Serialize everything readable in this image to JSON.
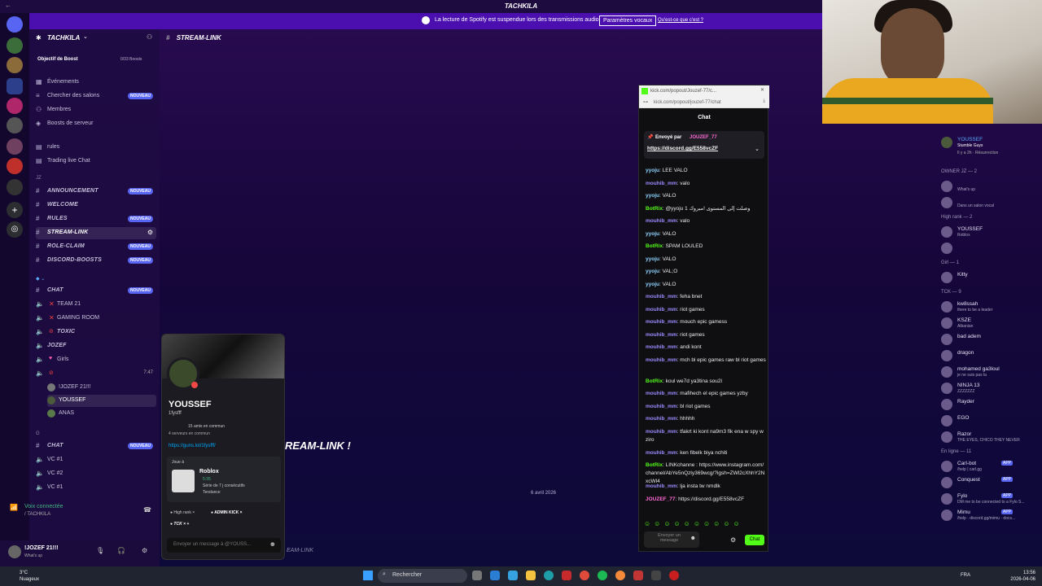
{
  "window": {
    "title": "TACHKILA"
  },
  "notice": {
    "message": "La lecture de Spotify est suspendue lors des transmissions audio.",
    "button": "Paramètres vocaux",
    "link": "Qu'est-ce que c'est ?"
  },
  "sidebar": {
    "guild_name": "TACHKILA",
    "boost_label": "Objectif de Boost",
    "boost_count": "0/33 Boosts",
    "top_items": [
      {
        "label": "Événements"
      },
      {
        "label": "Chercher des salons",
        "tag": "NOUVEAU"
      },
      {
        "label": "Membres"
      },
      {
        "label": "Boosts de serveur"
      }
    ],
    "misc_items": [
      {
        "label": "rules"
      },
      {
        "label": "Trading live Chat"
      }
    ],
    "cat_jz": "JZ",
    "jz_channels": [
      {
        "label": "ANNOUNCEMENT",
        "tag": "NOUVEAU"
      },
      {
        "label": "WELCOME"
      },
      {
        "label": "RULES",
        "tag": "NOUVEAU"
      },
      {
        "label": "STREAM-LINK"
      },
      {
        "label": "ROLE-CLAIM",
        "tag": "NOUVEAU"
      },
      {
        "label": "DISCORD-BOOSTS",
        "tag": "NOUVEAU"
      }
    ],
    "chat_channel": {
      "label": "CHAT",
      "tag": "NOUVEAU"
    },
    "voice_channels": [
      {
        "label": "TEAM 21"
      },
      {
        "label": "GAMING ROOM"
      },
      {
        "label": "TOXIC"
      },
      {
        "label": "JOZEF"
      },
      {
        "label": "Girls"
      }
    ],
    "voice_time": "7:47",
    "voice_users": [
      "!JOZEF 21!!!",
      "YOUSSEF",
      "ANAS"
    ],
    "cat_g": "G",
    "g_channels": [
      {
        "label": "CHAT",
        "tag": "NOUVEAU"
      },
      {
        "label": "VC #1"
      },
      {
        "label": "VC #2"
      },
      {
        "label": "VC #1"
      }
    ],
    "voice_status": "Voix connectée",
    "voice_server": "/ TACHKILA",
    "user_name": "!JOZEF 21!!!",
    "user_status": "What's up"
  },
  "channel_header": "STREAM-LINK",
  "stream": {
    "overlay_text": "REAM-LINK !",
    "date": "6 avril 2026",
    "footer": "EAM-LINK"
  },
  "profile": {
    "name": "YOUSSEF",
    "handle": "1fysfff",
    "mutual_friends": "15 amis en commun",
    "mutual_servers": "4 serveurs en commun",
    "link": "https://guns.lol/1fysfff/",
    "playing_label": "Joue à",
    "game": "Roblox",
    "game_time": "5:35",
    "streak": "Série de 7 j consécutifs",
    "trend": "Tendance",
    "roles": [
      "High rank",
      "ADMIN KICK",
      "TCK"
    ],
    "message_placeholder": "Envoyer un message à @YOUSS..."
  },
  "kick": {
    "tab_title": "kick.com/popout/Jouzef-77/c...",
    "url": "kick.com/popout/jouzef-77/chat",
    "title": "Chat",
    "pinned_by_label": "Envoyé par",
    "pinned_by": "JOUZEF_77",
    "pinned_link": "https://discord.gg/E558vcZF",
    "messages": [
      {
        "u": "yyoju",
        "t": "LEE VALO",
        "c": "#8fd3ff"
      },
      {
        "u": "mouhib_mm",
        "t": "valo",
        "c": "#9b8cff"
      },
      {
        "u": "yyoju",
        "t": "VALO",
        "c": "#8fd3ff"
      },
      {
        "u": "BotRix",
        "t": "@yyoju 1 وصلت إلى المستوى !مبروك",
        "c": "#53fc18"
      },
      {
        "u": "mouhib_mm",
        "t": "valo",
        "c": "#9b8cff"
      },
      {
        "u": "yyoju",
        "t": "VALO",
        "c": "#8fd3ff"
      },
      {
        "u": "BotRix",
        "t": "SPAM LOULED",
        "c": "#53fc18"
      },
      {
        "u": "yyoju",
        "t": "VALO",
        "c": "#8fd3ff"
      },
      {
        "u": "yyoju",
        "t": "VAL;O",
        "c": "#8fd3ff"
      },
      {
        "u": "yyoju",
        "t": "VALO",
        "c": "#8fd3ff"
      },
      {
        "u": "mouhib_mm",
        "t": "feha bnet",
        "c": "#9b8cff"
      },
      {
        "u": "mouhib_mm",
        "t": "riot games",
        "c": "#9b8cff"
      },
      {
        "u": "mouhib_mm",
        "t": "mouch epic gamess",
        "c": "#9b8cff"
      },
      {
        "u": "mouhib_mm",
        "t": "riot games",
        "c": "#9b8cff"
      },
      {
        "u": "mouhib_mm",
        "t": "andi kont",
        "c": "#9b8cff"
      },
      {
        "u": "mouhib_mm",
        "t": "mch bl epic games raw bl riot games",
        "c": "#9b8cff"
      },
      {
        "u": "BotRix",
        "t": "koul we7d ya3tina sou2l",
        "c": "#53fc18"
      },
      {
        "u": "mouhib_mm",
        "t": "mafihech el epic games yzby",
        "c": "#9b8cff"
      },
      {
        "u": "mouhib_mm",
        "t": "bl riot games",
        "c": "#9b8cff"
      },
      {
        "u": "mouhib_mm",
        "t": "hhhhh",
        "c": "#9b8cff"
      },
      {
        "u": "mouhib_mm",
        "t": "tfakrt ki kont na9m3 fik ena w spy w ziro",
        "c": "#9b8cff"
      },
      {
        "u": "mouhib_mm",
        "t": "ken fibelk biya nchiti",
        "c": "#9b8cff"
      },
      {
        "u": "BotRix",
        "t": "LINKchanne : https://www.instagram.com/channel/AbYe5nQzly369wcg/?igsh=ZWl2cXhhY2NxcWl4",
        "c": "#53fc18"
      },
      {
        "u": "mouhib_mm",
        "t": "lja insta tw nmdlk",
        "c": "#9b8cff"
      },
      {
        "u": "JOUZEF_77",
        "t": "https://discord.gg/E558vcZF",
        "c": "#ff6bd6"
      }
    ],
    "input_placeholder": "Envoyer un message",
    "send": "Chat"
  },
  "members": {
    "top_user": {
      "name": "YOUSSEF",
      "activity": "Stumble Guys",
      "sub": "Il y a 2h · Résurrection"
    },
    "groups": [
      {
        "label": "OWNER JZ — 2",
        "items": [
          {
            "name": "",
            "status": "What's up"
          },
          {
            "name": "",
            "status": "Dans un salon vocal"
          }
        ]
      },
      {
        "label": "High rank — 2",
        "items": [
          {
            "name": "YOUSSEF",
            "status": "Roblox"
          },
          {
            "name": "",
            "status": ""
          }
        ]
      },
      {
        "label": "Girl — 1",
        "items": [
          {
            "name": "Kitty",
            "status": ""
          }
        ]
      },
      {
        "label": "TCK — 9",
        "items": [
          {
            "name": "kw8ssah",
            "status": "there to be a leader"
          },
          {
            "name": "KSZE",
            "status": "Albanian"
          },
          {
            "name": "bad adem",
            "status": ""
          },
          {
            "name": "dragon",
            "status": ""
          },
          {
            "name": "mohamed ga3loul",
            "status": "je ne suis pas la"
          },
          {
            "name": "NINJA 13",
            "status": "ZZZZZZZ"
          },
          {
            "name": "Rayder",
            "status": ""
          },
          {
            "name": "EGO",
            "status": ""
          },
          {
            "name": "Razor",
            "status": "THE EYES, CHICO THEY NEVER"
          }
        ]
      },
      {
        "label": "En ligne — 11",
        "items": [
          {
            "name": "Carl-bot",
            "status": "/help | carl.gg"
          },
          {
            "name": "Conquest",
            "status": ""
          },
          {
            "name": "Fylo",
            "status": "DM me to be connected to a Fylo S..."
          },
          {
            "name": "Mimu",
            "status": "/help · discord.gg/mimu · docs..."
          }
        ]
      }
    ],
    "app_tag": "APP"
  },
  "taskbar": {
    "weather_temp": "3°C",
    "weather_desc": "Nuageux",
    "search": "Rechercher",
    "lang": "FRA",
    "time": "13:56",
    "date": "2026-04-06"
  }
}
